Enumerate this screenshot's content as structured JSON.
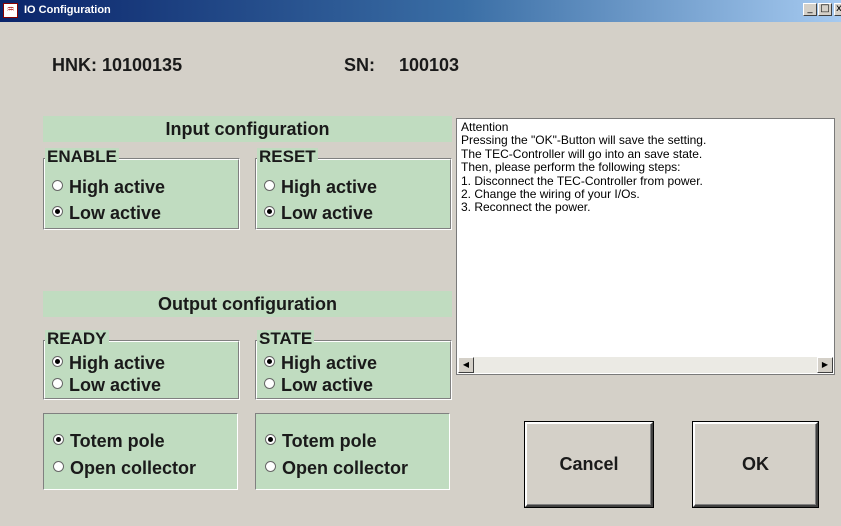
{
  "window": {
    "title": "IO Configuration",
    "app_icon": "app-icon",
    "controls": {
      "minimize": "_",
      "maximize": "□",
      "close": "x"
    }
  },
  "header": {
    "hnk_label": "HNK: 10100135",
    "sn_label": "SN:",
    "sn_value": "100103"
  },
  "input_config": {
    "title": "Input configuration",
    "enable": {
      "label": "ENABLE",
      "options": [
        "High active",
        "Low active"
      ],
      "selected": "Low active"
    },
    "reset": {
      "label": "RESET",
      "options": [
        "High active",
        "Low active"
      ],
      "selected": "Low active"
    }
  },
  "output_config": {
    "title": "Output configuration",
    "ready": {
      "label": "READY",
      "options": [
        "High active",
        "Low active"
      ],
      "selected": "High active"
    },
    "state": {
      "label": "STATE",
      "options": [
        "High active",
        "Low active"
      ],
      "selected": "High active"
    },
    "ready_drive": {
      "options": [
        "Totem pole",
        "Open collector"
      ],
      "selected": "Totem pole"
    },
    "state_drive": {
      "options": [
        "Totem pole",
        "Open collector"
      ],
      "selected": "Totem pole"
    }
  },
  "info_text": [
    "Attention",
    "Pressing the \"OK\"-Button will save the setting.",
    "The TEC-Controller will go into an save state.",
    "Then, please perform the following steps:",
    "1. Disconnect the TEC-Controller from power.",
    "2. Change the wiring of your I/Os.",
    "3. Reconnect the power."
  ],
  "buttons": {
    "cancel": "Cancel",
    "ok": "OK"
  }
}
